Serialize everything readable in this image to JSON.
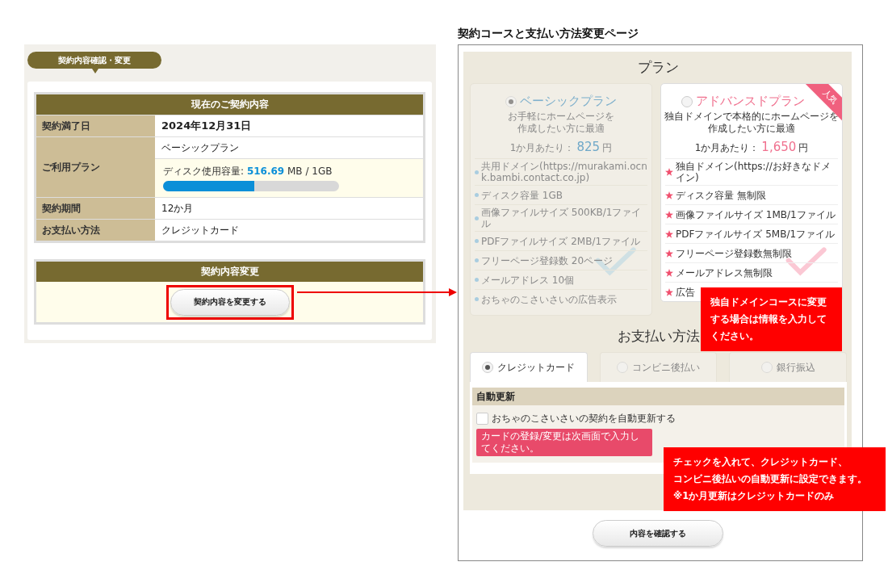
{
  "left_panel": {
    "heading": "契約内容確認・変更",
    "current": {
      "title": "現在のご契約内容",
      "rows": [
        {
          "kind": "date",
          "label": "契約満了日",
          "value": "2024年12月31日"
        },
        {
          "kind": "plan",
          "label": "ご利用プラン",
          "value": "ベーシックプラン",
          "disk": {
            "label": "ディスク使用容量:",
            "used": "516.69",
            "unit": "MB / 1GB",
            "level": 0.52
          }
        },
        {
          "kind": "text",
          "label": "契約期間",
          "value": "12か月"
        },
        {
          "kind": "text",
          "label": "お支払い方法",
          "value": "クレジットカード"
        }
      ]
    },
    "change": {
      "title": "契約内容変更",
      "button": "契約内容を変更する"
    }
  },
  "right_panel": {
    "title": "契約コースと支払い方法変更ページ",
    "plans_title": "プラン",
    "plans": [
      {
        "name": "ベーシックプラン",
        "selected": true,
        "dimmed": true,
        "description": [
          "お手軽にホームページを",
          "作成したい方に最適"
        ],
        "price_label": "1か月あたり：",
        "price": "825",
        "currency": "円",
        "features": [
          "共用ドメイン(https://murakami.ocnk.bambi.contact.co.jp)",
          "ディスク容量 1GB",
          "画像ファイルサイズ 500KB/1ファイル",
          "PDFファイルサイズ 2MB/1ファイル",
          "フリーページ登録数 20ページ",
          "メールアドレス 10個",
          "おちゃのこさいさいの広告表示"
        ]
      },
      {
        "name": "アドバンスドプラン",
        "selected": false,
        "dimmed": false,
        "badge": "人気",
        "description": [
          "独自ドメインで本格的にホームページを",
          "作成したい方に最適"
        ],
        "price_label": "1か月あたり：",
        "price": "1,650",
        "currency": "円",
        "features": [
          "独自ドメイン(https://お好きなドメイン)",
          "ディスク容量 無制限",
          "画像ファイルサイズ 1MB/1ファイル",
          "PDFファイルサイズ 5MB/1ファイル",
          "フリーページ登録数無制限",
          "メールアドレス無制限",
          "広告"
        ]
      }
    ],
    "payment_title": "お支払い方法",
    "payment_tabs": [
      {
        "label": "クレジットカード",
        "selected": true
      },
      {
        "label": "コンビニ後払い",
        "selected": false
      },
      {
        "label": "銀行振込",
        "selected": false
      }
    ],
    "auto_renew": {
      "title": "自動更新",
      "label": "おちゃのこさいさいの契約を自動更新する",
      "checked": false,
      "note": "カードの登録/変更は次画面で入力してください。"
    },
    "confirm_button": "内容を確認する"
  },
  "callouts": [
    {
      "lines": [
        "独自ドメインコースに変更",
        "する場合は情報を入力して",
        "ください。"
      ]
    },
    {
      "lines": [
        "チェックを入れて、クレジットカード、",
        "コンビニ後払いの自動更新に設定できます。",
        "※1か月更新はクレジットカードのみ"
      ]
    }
  ]
}
